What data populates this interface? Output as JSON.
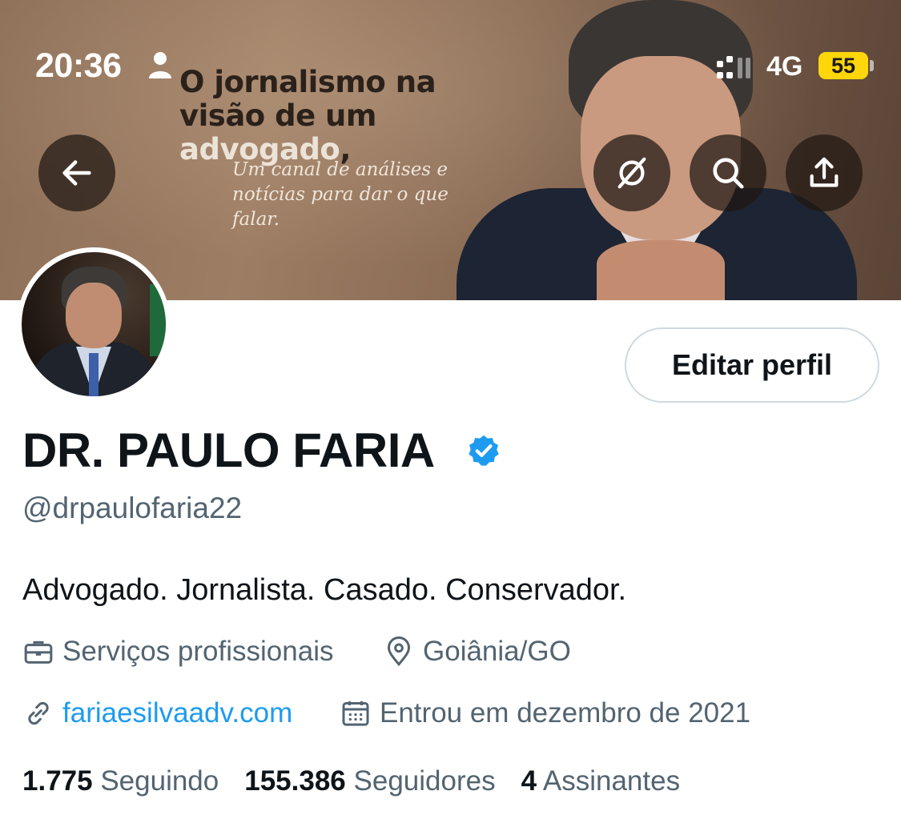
{
  "status_bar": {
    "time": "20:36",
    "network": "4G",
    "battery_level": "55",
    "battery_color": "#ffd60a"
  },
  "banner": {
    "headline_dark_1": "O jornalismo na",
    "headline_dark_2": "visão de um ",
    "headline_light": "advogado",
    "headline_comma": ",",
    "tagline_line1": "Um canal de análises e",
    "tagline_line2": "notícias para dar o que falar."
  },
  "header_actions": {
    "back_icon": "arrow-left-icon",
    "grok_icon": "grok-icon",
    "search_icon": "search-icon",
    "share_icon": "share-icon"
  },
  "profile": {
    "edit_button_label": "Editar perfil",
    "display_name": "DR. PAULO FARIA",
    "verified_color": "#1d9bf0",
    "handle": "@drpaulofaria22",
    "bio": "Advogado. Jornalista. Casado. Conservador.",
    "category": "Serviços profissionais",
    "location": "Goiânia/GO",
    "website": "fariaesilvaadv.com",
    "joined": "Entrou em dezembro de 2021"
  },
  "stats": {
    "following_count": "1.775",
    "following_label": "Seguindo",
    "followers_count": "155.386",
    "followers_label": "Seguidores",
    "subscribers_count": "4",
    "subscribers_label": "Assinantes"
  },
  "colors": {
    "link": "#1d9bf0",
    "secondary_text": "#536471",
    "primary_text": "#0f1419"
  }
}
